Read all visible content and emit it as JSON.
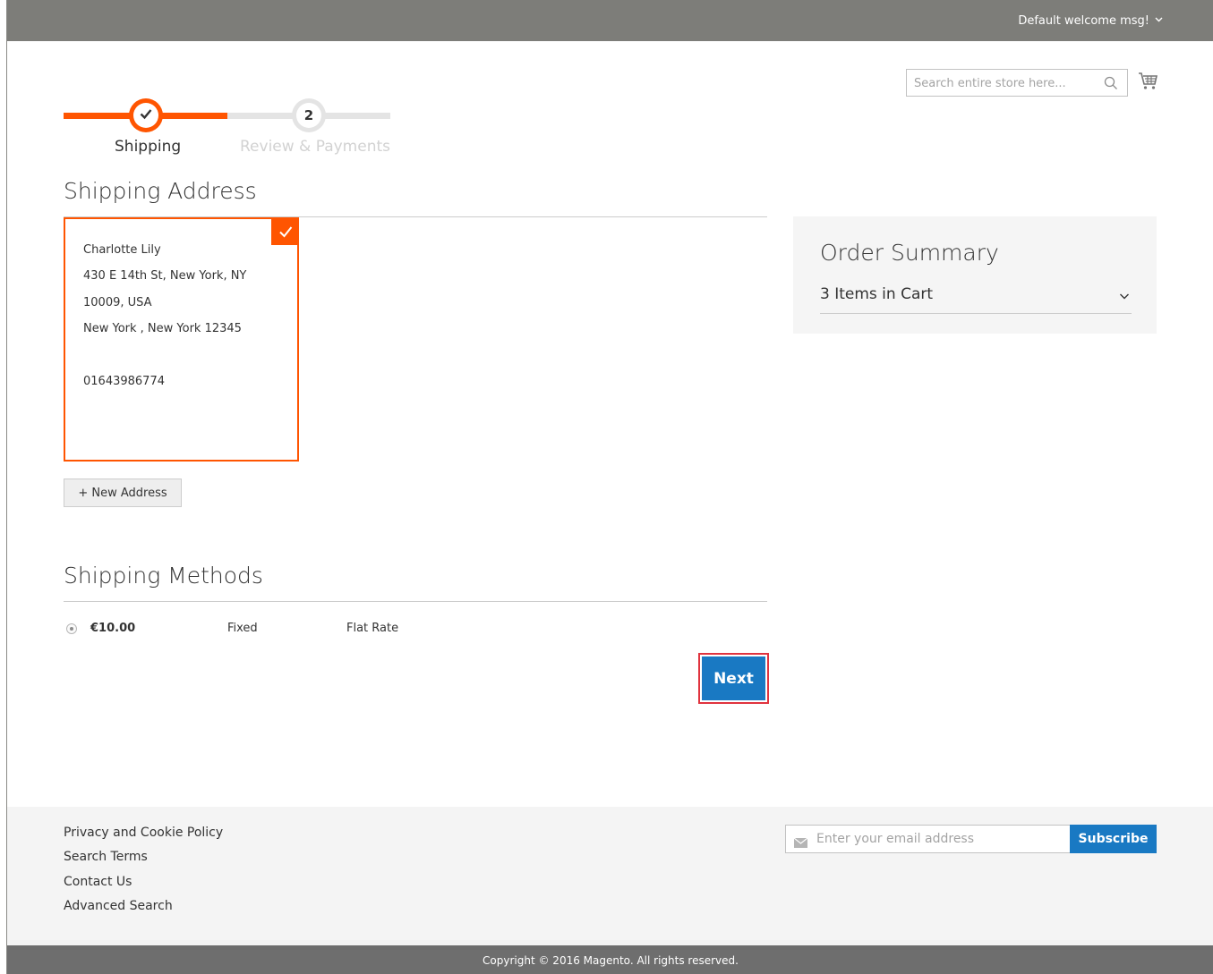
{
  "header": {
    "welcome": "Default welcome msg!",
    "search_placeholder": "Search entire store here...",
    "icons": [
      "chevron-down-icon",
      "search-icon",
      "cart-icon"
    ]
  },
  "progress": {
    "steps": [
      {
        "label": "Shipping",
        "status": "complete"
      },
      {
        "number": "2",
        "label": "Review & Payments",
        "status": "pending"
      }
    ]
  },
  "shipping_address": {
    "title": "Shipping Address",
    "card": {
      "lines": [
        "Charlotte Lily",
        "430 E 14th St, New York, NY",
        "10009, USA",
        "New York , New York 12345",
        "01643986774"
      ]
    },
    "new_address_label": "+ New Address"
  },
  "shipping_methods": {
    "title": "Shipping Methods",
    "methods": [
      {
        "price": "€10.00",
        "type": "Fixed",
        "carrier": "Flat Rate",
        "selected": true
      }
    ],
    "next_label": "Next"
  },
  "order_summary": {
    "title": "Order Summary",
    "items": "3 Items in Cart"
  },
  "footer": {
    "links": [
      "Privacy and Cookie Policy",
      "Search Terms",
      "Contact Us",
      "Advanced Search"
    ],
    "newsletter_placeholder": "Enter your email address",
    "subscribe_label": "Subscribe",
    "copyright": "Copyright © 2016 Magento. All rights reserved."
  },
  "colors": {
    "accent": "#ff5501",
    "primary_button": "#1979c3",
    "topbar": "#7d7d79",
    "highlight": "#e0333e"
  }
}
